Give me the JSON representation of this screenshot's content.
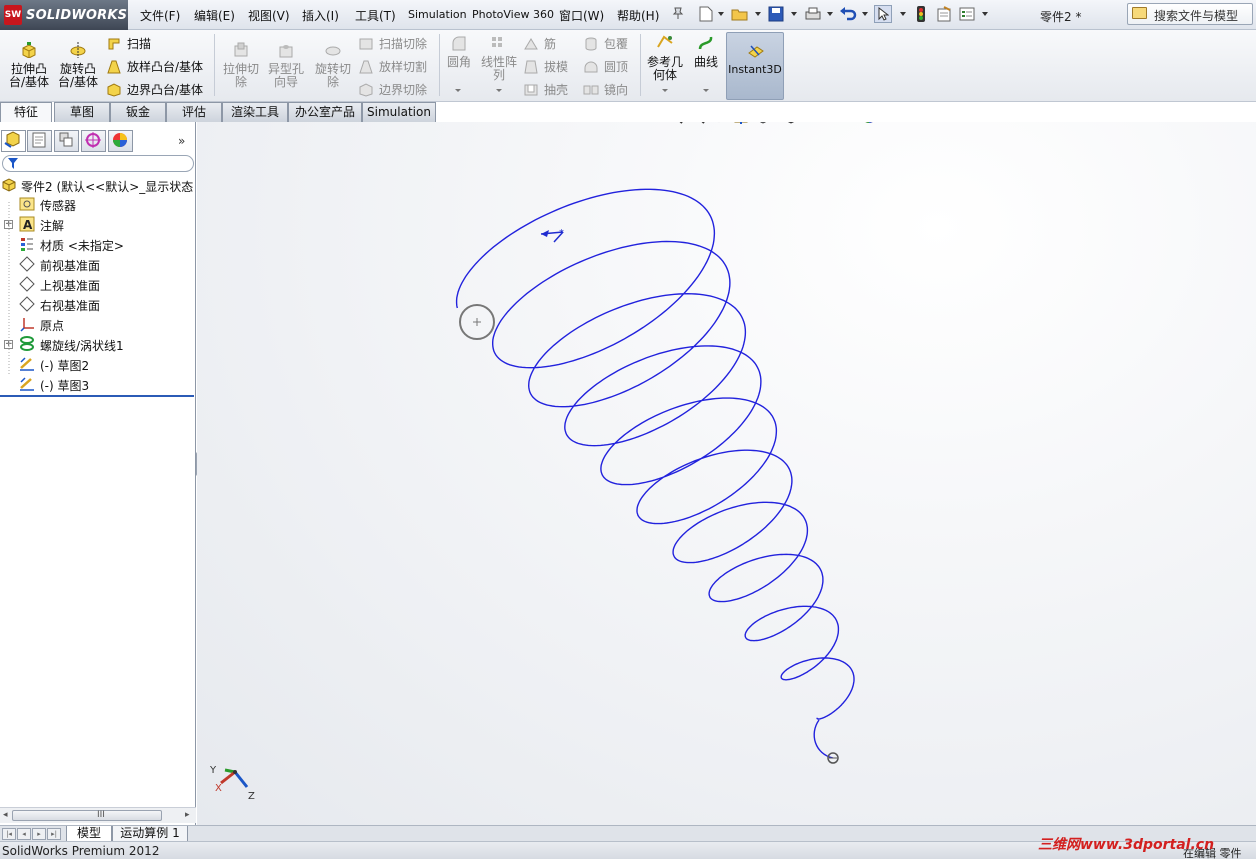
{
  "app": {
    "logo_text": "SOLIDWORKS",
    "logo_badge": "SW",
    "doc_title": "零件2 *",
    "search_label": "搜索文件与模型"
  },
  "menu": [
    "文件(F)",
    "编辑(E)",
    "视图(V)",
    "插入(I)",
    "工具(T)",
    "Simulation",
    "PhotoView 360",
    "窗口(W)",
    "帮助(H)"
  ],
  "ribbon": {
    "extrude_boss": "拉伸凸\n台/基体",
    "revolve_boss": "旋转凸\n台/基体",
    "sweep": "扫描",
    "loft_boss": "放样凸台/基体",
    "boundary_boss": "边界凸台/基体",
    "extrude_cut": "拉伸切\n除",
    "hole_wizard": "异型孔\n向导",
    "revolve_cut": "旋转切\n除",
    "swept_cut": "扫描切除",
    "lofted_cut": "放样切割",
    "boundary_cut": "边界切除",
    "fillet": "圆角",
    "linear_pattern": "线性阵\n列",
    "rib": "筋",
    "draft": "拔模",
    "shell": "抽壳",
    "wrap": "包覆",
    "dome": "圆顶",
    "mirror": "镜向",
    "ref_geometry": "参考几\n何体",
    "curves": "曲线",
    "instant3d": "Instant3D"
  },
  "tabs": [
    "特征",
    "草图",
    "钣金",
    "评估",
    "渲染工具",
    "办公室产品",
    "Simulation"
  ],
  "tree": {
    "root": "零件2  (默认<<默认>_显示状态",
    "items": [
      {
        "label": "传感器",
        "icon": "sensor-icon"
      },
      {
        "label": "注解",
        "icon": "annotation-icon"
      },
      {
        "label": "材质 <未指定>",
        "icon": "material-icon"
      },
      {
        "label": "前视基准面",
        "icon": "plane-icon"
      },
      {
        "label": "上视基准面",
        "icon": "plane-icon"
      },
      {
        "label": "右视基准面",
        "icon": "plane-icon"
      },
      {
        "label": "原点",
        "icon": "origin-icon"
      },
      {
        "label": "螺旋线/涡状线1",
        "icon": "helix-icon"
      },
      {
        "label": "(-) 草图2",
        "icon": "sketch-icon"
      },
      {
        "label": "(-) 草图3",
        "icon": "sketch-icon"
      }
    ]
  },
  "triad": {
    "x": "X",
    "y": "Y",
    "z": "Z"
  },
  "bottom_tabs": [
    "模型",
    "运动算例 1"
  ],
  "status": {
    "left": "SolidWorks Premium 2012",
    "right": "在编辑 零件"
  },
  "watermark": "三维网www.3dportal.cn",
  "colors": {
    "helix": "#2222dd",
    "profile_circle": "#777777",
    "ribbon_bg": "#eef0f4",
    "logo_bg": "#4b5564",
    "accent_red": "#c8161d"
  }
}
